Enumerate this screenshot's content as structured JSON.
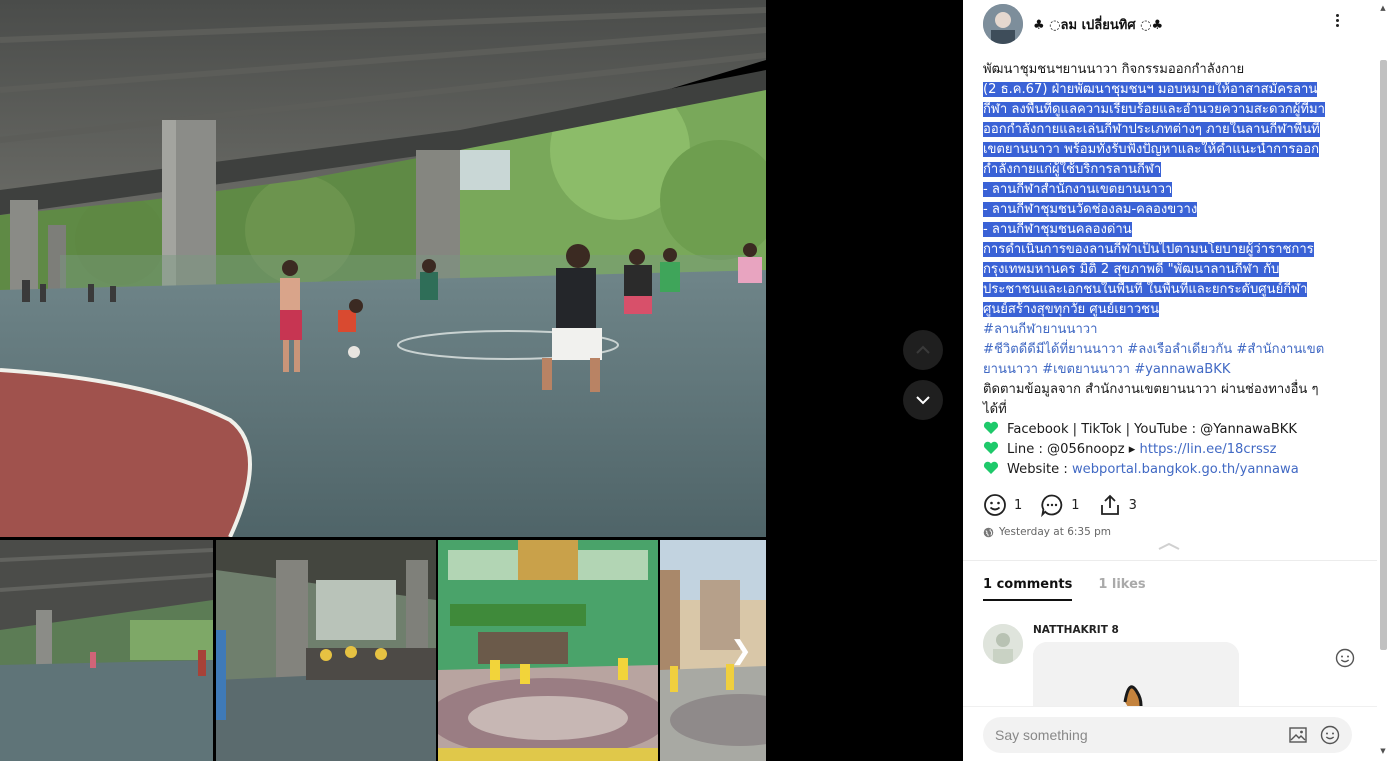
{
  "post": {
    "author": "♣ ◌ลม เปลี่ยนทิศ ◌♣",
    "intro": "พัฒนาชุมชนฯยานนาวา กิจกรรมออกกำลังกาย",
    "highlighted_lines": [
      " (2 ธ.ค.67)  ฝ่ายพัฒนาชุมชนฯ มอบหมายให้อาสาสมัครลาน",
      "กีฬา ลงพื้นที่ดูแลความเรียบร้อยและอำนวยความสะดวกผู้ที่มา",
      "ออกกำลังกายและเล่นกีฬาประเภทต่างๆ ภายในลานกีฬาพื้นที่",
      "เขตยานนาวา พร้อมทั้งรับฟังปัญหาและให้คำแนะนำการออก",
      "กำลังกายแก่ผู้ใช้บริการลานกีฬา",
      "- ลานกีฬาสำนักงานเขตยานนาวา",
      "- ลานกีฬาชุมชนวัดช่องลม-คลองขวาง",
      "- ลานกีฬาชุมชนคลองด่าน ",
      "   การดำเนินการของลานกีฬาเป็นไปตามนโยบายผู้ว่าราชการ",
      "กรุงเทพมหานคร  มิติ 2 สุขภาพดี  \"พัฒนาลานกีฬา กับ",
      "ประชาชนและเอกชนในพื้นที่ ในพื้นที่และยกระดับศูนย์กีฬา ",
      "ศูนย์สร้างสุขทุกวัย ศูนย์เยาวชน"
    ],
    "hashtag_line1": "#ลานกีฬายานนาวา",
    "hashtag_line2": "#ชีวิตดีดีมีได้ที่ยานนาวา #ลงเรือลำเดียวกัน #สำนักงานเขต",
    "hashtag_line3": "ยานนาวา #เขตยานนาวา #yannawaBKK",
    "follow_line1": "ติดตามข้อมูลจาก สำนักงานเขตยานนาวา ผ่านช่องทางอื่น ๆ",
    "follow_line2": "ได้ที่",
    "facebook_text": "Facebook | TikTok | YouTube : @YannawaBKK",
    "line_prefix": "Line : @056noopz ▸ ",
    "line_link": "https://lin.ee/18crssz",
    "website_prefix": "Website : ",
    "website_link": "webportal.bangkok.go.th/yannawa"
  },
  "actions": {
    "reactions_count": "1",
    "comments_count": "1",
    "shares_count": "3"
  },
  "timestamp": "Yesterday at 6:35 pm",
  "tabs": {
    "comments": "1 comments",
    "likes": "1 likes"
  },
  "comment": {
    "author": "NATTHAKRIT 8"
  },
  "composer": {
    "placeholder": "Say something"
  },
  "colors": {
    "highlight": "#3a62d6",
    "link": "#4169c4",
    "heart": "#1ec96a"
  },
  "icons": {
    "more": "more-vertical-icon",
    "reaction": "smile-icon",
    "comment": "comment-bubble-icon",
    "share": "share-icon",
    "privacy": "globe-icon",
    "heart": "green-heart-icon",
    "photo": "image-icon",
    "emoji": "emoji-icon"
  }
}
